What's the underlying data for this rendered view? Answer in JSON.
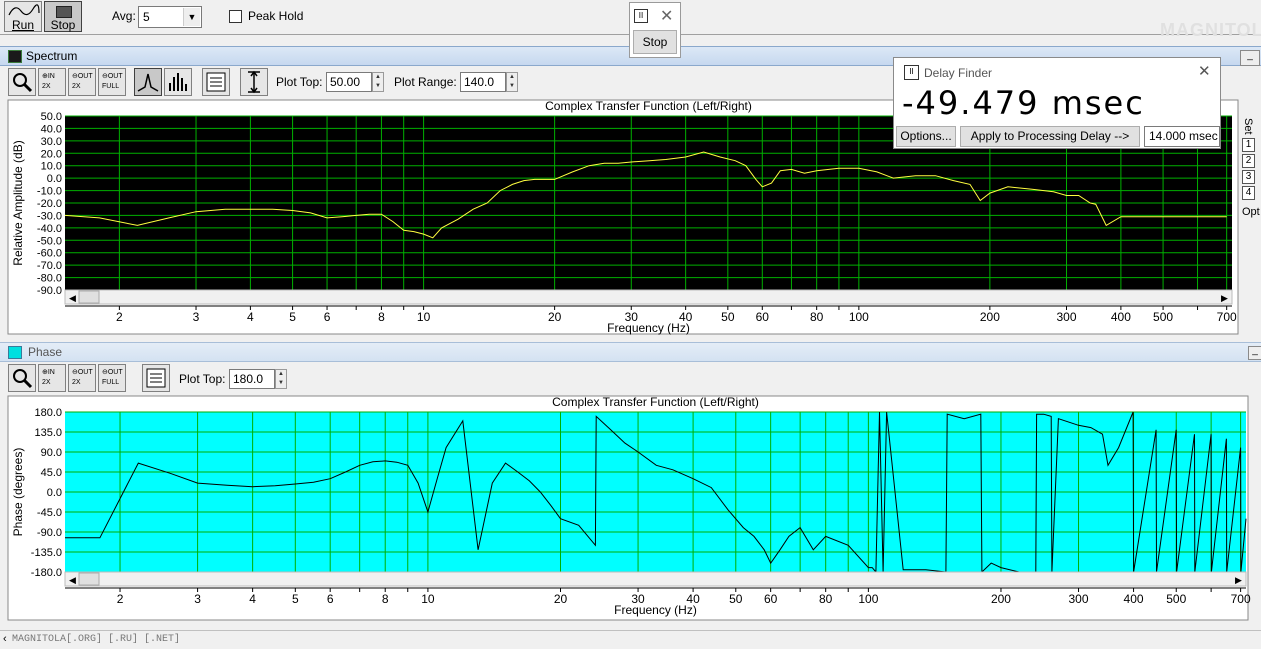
{
  "toolbar": {
    "run_label": "Run",
    "stop_label": "Stop",
    "avg_label": "Avg:",
    "avg_value": "5",
    "peak_hold_label": "Peak Hold"
  },
  "stop_popup": {
    "stop_label": "Stop"
  },
  "watermark": "MAGNITOLA",
  "spectrum": {
    "window_title": "Spectrum",
    "plot_top_label": "Plot Top:",
    "plot_top_value": "50.00",
    "plot_range_label": "Plot Range:",
    "plot_range_value": "140.0"
  },
  "phase": {
    "window_title": "Phase",
    "plot_top_label": "Plot Top:",
    "plot_top_value": "180.0"
  },
  "delay_finder": {
    "title": "Delay Finder",
    "readout": "-49.479 msec",
    "options_label": "Options...",
    "apply_label": "Apply to Processing Delay -->",
    "delay_value": "14.000 msec"
  },
  "side_panel": {
    "set_label": "Set",
    "items": [
      "1",
      "2",
      "3",
      "4"
    ],
    "opt_label": "Opt"
  },
  "status_bar": {
    "text": "MAGNITOLA[.ORG] [.RU] [.NET]"
  },
  "colors": {
    "spectrum_bg": "#000000",
    "grid": "#00b000",
    "spectrum_trace": "#ffff40",
    "phase_bg": "#00ffff",
    "phase_trace": "#000000"
  },
  "chart_data": [
    {
      "type": "line",
      "title": "Complex Transfer Function (Left/Right)",
      "xlabel": "Frequency (Hz)",
      "ylabel": "Relative Amplitude (dB)",
      "x_scale": "log",
      "xlim": [
        1.5,
        720
      ],
      "ylim": [
        -90,
        50
      ],
      "y_ticks": [
        "50.0",
        "40.0",
        "30.0",
        "20.0",
        "10.0",
        "0.0",
        "-10.0",
        "-20.0",
        "-30.0",
        "-40.0",
        "-50.0",
        "-60.0",
        "-70.0",
        "-80.0",
        "-90.0"
      ],
      "x_ticks": [
        "2",
        "3",
        "4",
        "5",
        "6",
        "8",
        "10",
        "20",
        "30",
        "40",
        "50",
        "60",
        "80",
        "100",
        "200",
        "300",
        "400",
        "500",
        "700"
      ],
      "series": [
        {
          "x": [
            1.5,
            1.8,
            2.2,
            2.6,
            3.0,
            3.5,
            4.0,
            4.5,
            5.0,
            5.5,
            6.0,
            6.5,
            7.0,
            7.5,
            8.0,
            8.5,
            9.0,
            9.5,
            10.0,
            10.5,
            11.0,
            12.0,
            13.0,
            14.0,
            15.0,
            16.0,
            17.0,
            18.0,
            19.0,
            20.0,
            22.0,
            24.0,
            26.0,
            28.0,
            30.0,
            33.0,
            36.0,
            40.0,
            44.0,
            48.0,
            52.0,
            55.0,
            58.0,
            60.0,
            63.0,
            66.0,
            70.0,
            75.0,
            80.0,
            90.0,
            100.0,
            110.0,
            120.0,
            135.0,
            150.0,
            165.0,
            180.0,
            190.0,
            200.0,
            220.0,
            250.0,
            280.0,
            300.0,
            320.0,
            340.0,
            350.0,
            370.0,
            400.0,
            450.0,
            500.0,
            600.0,
            700.0
          ],
          "y": [
            -30,
            -32,
            -38,
            -32,
            -27,
            -25,
            -25,
            -25,
            -26,
            -28,
            -32,
            -31,
            -30,
            -29,
            -29,
            -35,
            -42,
            -43,
            -45,
            -48,
            -40,
            -33,
            -25,
            -20,
            -10,
            -5,
            -2,
            -1,
            -1,
            -1,
            5,
            10,
            12,
            12,
            13,
            14,
            15,
            17,
            21,
            17,
            14,
            10,
            -1,
            -7,
            -4,
            6,
            7,
            4,
            6,
            8,
            8,
            5,
            0,
            2,
            2,
            -2,
            -5,
            -18,
            -12,
            -7,
            -9,
            -11,
            -14,
            -14,
            -20,
            -21,
            -38,
            -31,
            -31,
            -31,
            -31,
            -31
          ]
        }
      ]
    },
    {
      "type": "line",
      "title": "Complex Transfer Function (Left/Right)",
      "xlabel": "Frequency (Hz)",
      "ylabel": "Phase (degrees)",
      "x_scale": "log",
      "xlim": [
        1.5,
        720
      ],
      "ylim": [
        -180,
        180
      ],
      "y_ticks": [
        "180.0",
        "135.0",
        "90.0",
        "45.0",
        "0.0",
        "-45.0",
        "-90.0",
        "-135.0",
        "-180.0"
      ],
      "x_ticks": [
        "2",
        "3",
        "4",
        "5",
        "6",
        "8",
        "10",
        "20",
        "30",
        "40",
        "50",
        "60",
        "80",
        "100",
        "200",
        "300",
        "400",
        "500",
        "700"
      ],
      "series": [
        {
          "x": [
            1.5,
            1.8,
            2.2,
            2.6,
            3.0,
            3.5,
            4.0,
            4.5,
            5.0,
            5.5,
            6.0,
            6.5,
            7.0,
            7.5,
            8.0,
            8.5,
            9.0,
            9.5,
            10.0,
            10.5,
            11.0,
            12.0,
            13.0,
            14.0,
            15.0,
            16.0,
            17.0,
            18.0,
            19.0,
            20.0,
            22.0,
            24.0,
            24.1,
            26.0,
            28.0,
            30.0,
            33.0,
            36.0,
            40.0,
            44.0,
            48.0,
            52.0,
            55.0,
            58.0,
            60.0,
            63.0,
            66.0,
            70.0,
            75.0,
            80.0,
            90.0,
            100.0,
            102.0,
            104.0,
            106.0,
            108.0,
            110.0,
            120.0,
            135.0,
            150.0,
            151.0,
            165.0,
            180.0,
            181.0,
            190.0,
            200.0,
            220.0,
            240.0,
            241.0,
            250.0,
            260.0,
            261.0,
            270.0,
            300.0,
            320.0,
            340.0,
            350.0,
            370.0,
            399.0,
            400.0,
            450.0,
            451.0,
            500.0,
            501.0,
            550.0,
            551.0,
            600.0,
            601.0,
            650.0,
            651.0,
            700.0,
            701.0,
            720.0
          ],
          "y": [
            -103,
            -103,
            65,
            42,
            20,
            15,
            12,
            14,
            18,
            22,
            30,
            45,
            60,
            68,
            70,
            67,
            60,
            20,
            -45,
            30,
            100,
            160,
            -130,
            20,
            65,
            45,
            25,
            0,
            -30,
            -60,
            -75,
            -120,
            170,
            140,
            110,
            90,
            60,
            50,
            30,
            10,
            -40,
            -80,
            -100,
            -130,
            -160,
            -130,
            -100,
            -80,
            -130,
            -100,
            -120,
            -170,
            -170,
            -180,
            180,
            -180,
            180,
            -175,
            -175,
            -180,
            175,
            165,
            175,
            -180,
            -160,
            -170,
            -180,
            -180,
            175,
            175,
            170,
            -180,
            165,
            150,
            145,
            130,
            60,
            100,
            180,
            -180,
            140,
            -180,
            140,
            -180,
            130,
            -180,
            130,
            -180,
            120,
            -180,
            100,
            -180,
            -60
          ]
        }
      ]
    }
  ]
}
